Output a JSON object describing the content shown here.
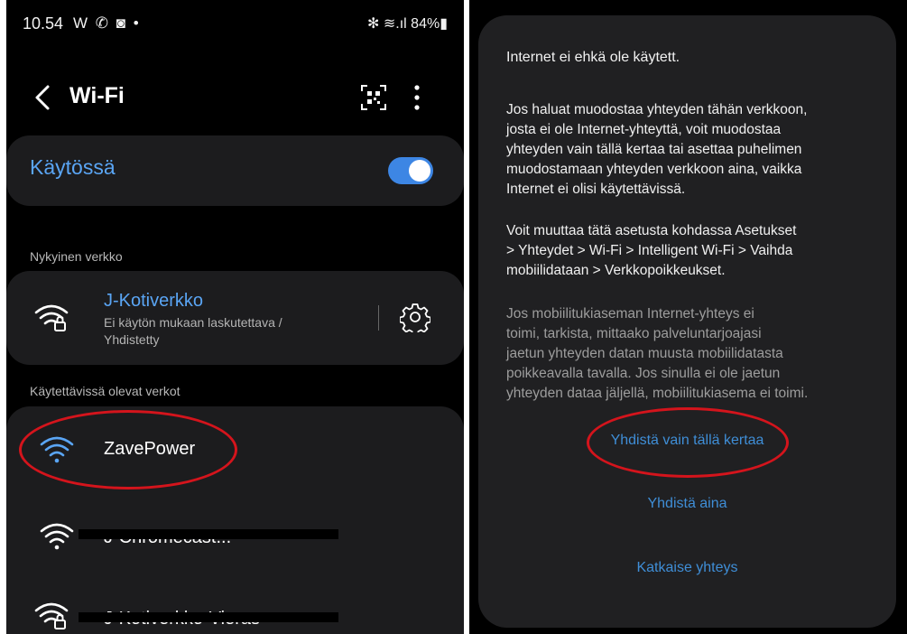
{
  "left": {
    "status_bar": {
      "time": "10.54",
      "left_icons": "W ✆ ◙ •",
      "right_text": "✻ ≋.ıl 84%▮"
    },
    "header": {
      "title": "Wi-Fi"
    },
    "toggle": {
      "label": "Käytössä",
      "state": "on"
    },
    "current_section": "Nykyinen verkko",
    "current_network": {
      "name": "J-Kotiverkko",
      "status_line1": "Ei käytön mukaan laskutettava /",
      "status_line2": "Yhdistetty"
    },
    "available_section": "Käytettävissä olevat verkot",
    "available_networks": [
      {
        "name": "ZavePower",
        "secured": false
      },
      {
        "name": "J-Chromecast...",
        "secured": false
      },
      {
        "name": "J-Kotiverkko-Vieras",
        "secured": true
      }
    ]
  },
  "dialog": {
    "title": "Internet ei ehkä ole käytett.",
    "para1_lines": [
      "Jos haluat muodostaa yhteyden tähän verkkoon,",
      "josta ei ole Internet-yhteyttä, voit muodostaa",
      "yhteyden vain tällä kertaa tai asettaa puhelimen",
      "muodostamaan yhteyden verkkoon aina, vaikka",
      "Internet ei olisi käytettävissä."
    ],
    "para2_lines": [
      "Voit muuttaa tätä asetusta kohdassa Asetukset",
      "> Yhteydet > Wi-Fi > Intelligent Wi-Fi > Vaihda",
      "mobiilidataan > Verkkopoikkeukset."
    ],
    "para3_lines": [
      "Jos mobiilitukiaseman Internet-yhteys ei",
      "toimi, tarkista, mittaako palveluntarjoajasi",
      "jaetun yhteyden datan muusta mobiilidatasta",
      "poikkeavalla tavalla. Jos sinulla ei ole jaetun",
      "yhteyden dataa jäljellä, mobiilitukiasema ei toimi."
    ],
    "btn_once": "Yhdistä vain tällä kertaa",
    "btn_always": "Yhdistä aina",
    "btn_disconnect": "Katkaise yhteys"
  },
  "colors": {
    "accent": "#3d86e4",
    "annotation": "#d4141c",
    "background": "#000000",
    "card": "#1c1c1e"
  },
  "icons": [
    "back-icon",
    "qr-scan-icon",
    "more-options-icon",
    "wifi-icon",
    "wifi-lock-icon",
    "settings-gear-icon"
  ]
}
